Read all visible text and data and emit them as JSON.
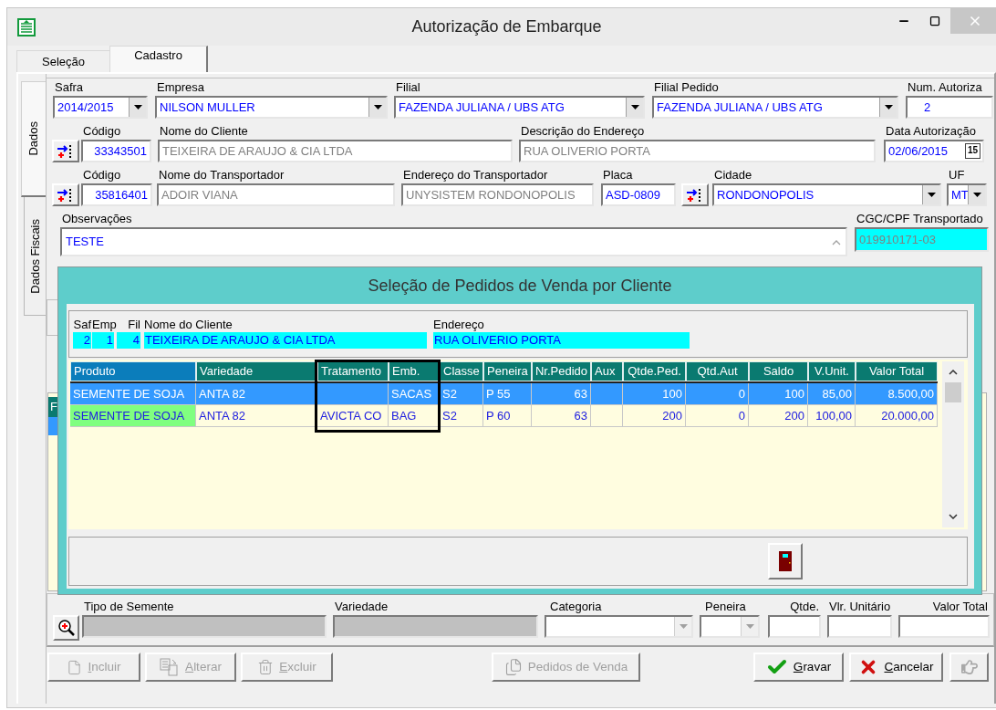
{
  "window": {
    "title": "Autorização de Embarque"
  },
  "tabs": [
    {
      "label": "Seleção",
      "selected": false
    },
    {
      "label": "Cadastro",
      "selected": true
    }
  ],
  "side_tabs": [
    {
      "label": "Dados",
      "selected": true
    },
    {
      "label": "Dados Fiscais",
      "selected": false
    }
  ],
  "form": {
    "rows": [
      {
        "fields": [
          {
            "kind": "combo",
            "label": "Safra",
            "value": "2014/2015",
            "disabled": false
          },
          {
            "kind": "combo",
            "label": "Empresa",
            "value": "NILSON MULLER",
            "disabled": false
          },
          {
            "kind": "combo",
            "label": "Filial",
            "value": "FAZENDA JULIANA / UBS ATG",
            "disabled": false
          },
          {
            "kind": "combo",
            "label": "Filial Pedido",
            "value": "FAZENDA JULIANA / UBS ATG",
            "disabled": false
          },
          {
            "kind": "counter",
            "label": "Num. Autoriza",
            "value": "2"
          }
        ]
      },
      {
        "fields": [
          {
            "kind": "lookup"
          },
          {
            "kind": "number",
            "label": "Código",
            "value": "33343501"
          },
          {
            "kind": "readonly",
            "label": "Nome do Cliente",
            "value": "TEIXEIRA DE ARAUJO & CIA LTDA"
          },
          {
            "kind": "readonly",
            "label": "Descrição do Endereço",
            "value": "RUA OLIVERIO PORTA"
          },
          {
            "kind": "date",
            "label": "Data Autorização",
            "value": "02/06/2015",
            "calendar_label": "15"
          }
        ]
      },
      {
        "fields": [
          {
            "kind": "lookup"
          },
          {
            "kind": "number",
            "label": "Código",
            "value": "35816401"
          },
          {
            "kind": "readonly",
            "label": "Nome do Transportador",
            "value": "ADOIR VIANA"
          },
          {
            "kind": "readonly",
            "label": "Endereço do Transportador",
            "value": "UNYSISTEM RONDONOPOLIS"
          },
          {
            "kind": "text",
            "label": "Placa",
            "value": "ASD-0809"
          },
          {
            "kind": "lookup"
          },
          {
            "kind": "combo",
            "label": "Cidade",
            "value": "RONDONOPOLIS",
            "disabled": false
          },
          {
            "kind": "combo",
            "label": "UF",
            "value": "MT",
            "disabled": false
          }
        ]
      },
      {
        "fields": [
          {
            "kind": "memo",
            "label": "Observações",
            "value": "TESTE"
          },
          {
            "kind": "cyan",
            "label": "CGC/CPF Transportado",
            "value": "019910171-03"
          }
        ]
      }
    ]
  },
  "background_grid": {
    "header": "F"
  },
  "dialog": {
    "title": "Seleção de Pedidos de Venda por Cliente",
    "header": [
      {
        "label": "Saf",
        "value": "2"
      },
      {
        "label": "Emp",
        "value": "1"
      },
      {
        "label": "Fil",
        "value": "4"
      },
      {
        "label": "Nome do Cliente",
        "value": "TEIXEIRA DE ARAUJO & CIA LTDA"
      },
      {
        "label": "Endereço",
        "value": "RUA OLIVERIO PORTA"
      }
    ],
    "grid": {
      "columns": [
        {
          "kind": "text",
          "label": "Produto",
          "active": true
        },
        {
          "kind": "text",
          "label": "Variedade",
          "active": false
        },
        {
          "kind": "text",
          "label": "Tratamento",
          "active": false
        },
        {
          "kind": "text",
          "label": "Emb.",
          "active": false
        },
        {
          "kind": "text",
          "label": "Classe",
          "active": false
        },
        {
          "kind": "text",
          "label": "Peneira",
          "active": false
        },
        {
          "kind": "number",
          "label": "Nr.Pedido",
          "active": false
        },
        {
          "kind": "text",
          "label": "Aux",
          "active": false
        },
        {
          "kind": "number",
          "label": "Qtde.Ped.",
          "active": false
        },
        {
          "kind": "number",
          "label": "Qtd.Aut",
          "active": false
        },
        {
          "kind": "number",
          "label": "Saldo",
          "active": false
        },
        {
          "kind": "number",
          "label": "V.Unit.",
          "active": false
        },
        {
          "kind": "number",
          "label": "Valor Total",
          "active": false
        }
      ],
      "rows": [
        {
          "selected": true,
          "marked": false,
          "cells": [
            "SEMENTE DE SOJA",
            "ANTA 82",
            "",
            "SACAS",
            "S2",
            "P 55",
            "63",
            "",
            "100",
            "0",
            "100",
            "85,00",
            "8.500,00"
          ]
        },
        {
          "selected": false,
          "marked": true,
          "cells": [
            "SEMENTE DE SOJA",
            "ANTA 82",
            "AVICTA CO",
            "BAG",
            "S2",
            "P 60",
            "63",
            "",
            "200",
            "0",
            "200",
            "100,00",
            "20.000,00"
          ]
        }
      ]
    }
  },
  "detail": {
    "fields": [
      {
        "kind": "search"
      },
      {
        "kind": "disabled",
        "label": "Tipo de Semente"
      },
      {
        "kind": "disabled",
        "label": "Variedade"
      },
      {
        "kind": "combo",
        "label": "Categoria",
        "disabled": true
      },
      {
        "kind": "combo",
        "label": "Peneira",
        "disabled": true
      },
      {
        "kind": "text",
        "label": "Qtde."
      },
      {
        "kind": "text",
        "label": "Vlr. Unitário"
      },
      {
        "kind": "text",
        "label": "Valor Total"
      }
    ]
  },
  "buttons": [
    {
      "kind": "new",
      "label": "Incluir",
      "disabled": true
    },
    {
      "kind": "edit",
      "label": "Alterar",
      "disabled": true
    },
    {
      "kind": "delete",
      "label": "Excluir",
      "disabled": true
    },
    {
      "kind": "orders",
      "label": "Pedidos de Venda",
      "disabled": true
    },
    {
      "kind": "save",
      "label": "Gravar",
      "disabled": false
    },
    {
      "kind": "cancel",
      "label": "Cancelar",
      "disabled": false
    },
    {
      "kind": "hand",
      "disabled": true
    }
  ]
}
